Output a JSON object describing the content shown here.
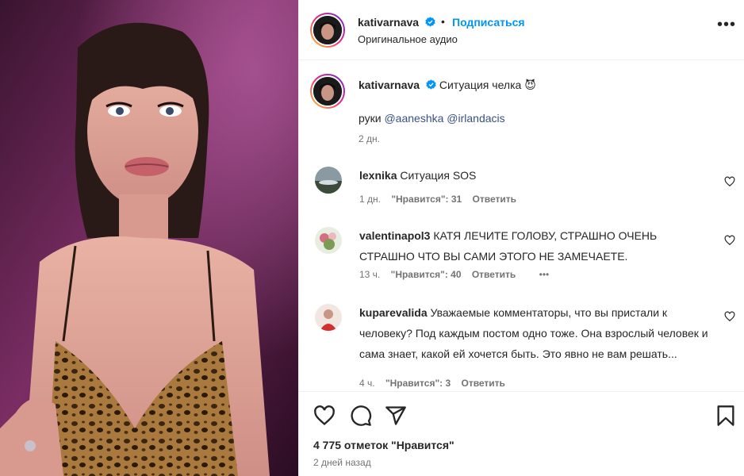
{
  "header": {
    "username": "kativarnava",
    "separator": "•",
    "follow_label": "Подписаться",
    "subtitle": "Оригинальное аудио",
    "more": "•••"
  },
  "caption": {
    "username": "kativarnava",
    "text": "Ситуация челка",
    "emoji": "😈",
    "line2_prefix": "руки",
    "mention1": "@aaneshka",
    "mention2": "@irlandacis",
    "time": "2 дн."
  },
  "comments": [
    {
      "username": "lexnika",
      "text": "Ситуация SOS",
      "time": "1 дн.",
      "likes": "\"Нравится\": 31",
      "reply": "Ответить"
    },
    {
      "username": "valentinapol3",
      "text": "КАТЯ ЛЕЧИТЕ ГОЛОВУ, СТРАШНО ОЧЕНЬ СТРАШНО ЧТО ВЫ САМИ ЭТОГО НЕ ЗАМЕЧАЕТЕ.",
      "time": "13 ч.",
      "likes": "\"Нравится\": 40",
      "reply": "Ответить",
      "more": "•••"
    },
    {
      "username": "kuparevalida",
      "text": "Уважаемые комментаторы, что вы пристали к человеку? Под каждым постом одно тоже. Она взрослый человек и сама знает, какой ей хочется быть. Это явно не вам решать...",
      "time": "4 ч.",
      "likes": "\"Нравится\": 3",
      "reply": "Ответить"
    }
  ],
  "actions": {
    "like_count": "4 775 отметок \"Нравится\"",
    "posted_ago": "2 дней назад",
    "icons": [
      "heart-icon",
      "comment-icon",
      "share-icon",
      "bookmark-icon"
    ]
  },
  "colors": {
    "link": "#0095f6",
    "mention": "#00376b",
    "muted": "#737373",
    "verified": "#0095f6"
  }
}
